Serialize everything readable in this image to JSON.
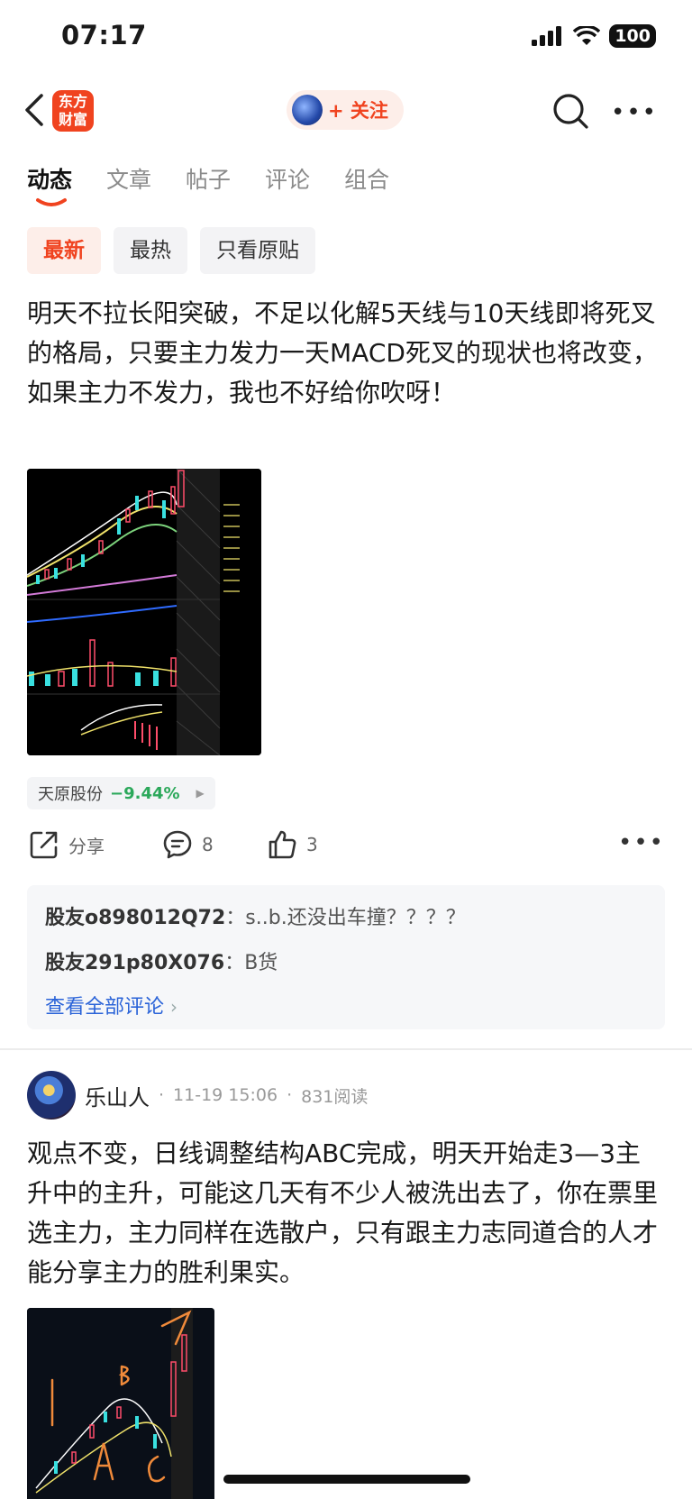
{
  "status_bar": {
    "time": "07:17",
    "battery": "100"
  },
  "header": {
    "logo_text": "东方\n财富",
    "follow_label": "+ 关注"
  },
  "tabs": [
    {
      "label": "动态",
      "active": true
    },
    {
      "label": "文章",
      "active": false
    },
    {
      "label": "帖子",
      "active": false
    },
    {
      "label": "评论",
      "active": false
    },
    {
      "label": "组合",
      "active": false
    }
  ],
  "filters": [
    {
      "label": "最新",
      "active": true
    },
    {
      "label": "最热",
      "active": false
    },
    {
      "label": "只看原贴",
      "active": false
    }
  ],
  "post1": {
    "text": "明天不拉长阳突破，不足以化解5天线与10天线即将死叉的格局，只要主力发力一天MACD死叉的现状也将改变，如果主力不发力，我也不好给你吹呀！",
    "stock_name": "天原股份",
    "stock_change": "−9.44%",
    "share_label": "分享",
    "comment_count": "8",
    "like_count": "3",
    "comments": [
      {
        "user": "股友o898012Q72",
        "text": "s..b.还没出车撞？？？？"
      },
      {
        "user": "股友291p80X076",
        "text": "B货"
      }
    ],
    "see_all": "查看全部评论"
  },
  "post2": {
    "author": "乐山人",
    "time": "11-19 15:06",
    "reads": "831阅读",
    "text": "观点不变，日线调整结构ABC完成，明天开始走3—3主升中的主升，可能这几天有不少人被洗出去了，你在票里选主力，主力同样在选散户，只有跟主力志同道合的人才能分享主力的胜利果实。"
  },
  "colors": {
    "accent": "#f0431f",
    "link": "#2a63d8",
    "down_green": "#2ba85a"
  },
  "icons": [
    "back-icon",
    "signal-icon",
    "wifi-icon",
    "search-icon",
    "more-icon",
    "share-icon",
    "comment-icon",
    "like-icon"
  ]
}
